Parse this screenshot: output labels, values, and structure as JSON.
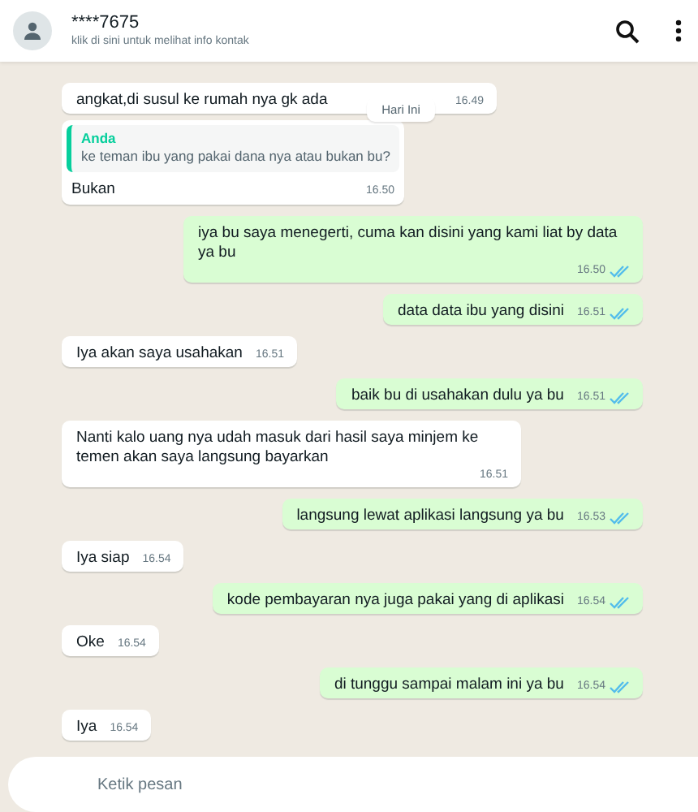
{
  "header": {
    "contact": "****7675",
    "subtitle": "klik di sini untuk melihat info kontak"
  },
  "messages": [
    {
      "kind": "incoming",
      "text": "angkat,di susul ke rumah nya gk ada",
      "time": "16.49"
    },
    {
      "kind": "date",
      "text": "Hari Ini"
    },
    {
      "kind": "incoming",
      "quote": {
        "author": "Anda",
        "text": "ke teman ibu yang pakai dana nya atau bukan bu?"
      },
      "text": "Bukan",
      "time": "16.50"
    },
    {
      "kind": "outgoing",
      "text": "iya bu saya menegerti, cuma kan disini yang kami liat by data ya bu",
      "time": "16.50",
      "read": true
    },
    {
      "kind": "outgoing",
      "text": "data data ibu yang disini",
      "time": "16.51",
      "read": true
    },
    {
      "kind": "incoming",
      "text": "Iya akan saya usahakan",
      "time": "16.51"
    },
    {
      "kind": "outgoing",
      "text": "baik bu di usahakan dulu ya bu",
      "time": "16.51",
      "read": true
    },
    {
      "kind": "incoming",
      "text": "Nanti kalo uang nya udah masuk dari hasil saya minjem ke temen akan saya langsung bayarkan",
      "time": "16.51"
    },
    {
      "kind": "outgoing",
      "text": "langsung lewat aplikasi langsung ya bu",
      "time": "16.53",
      "read": true
    },
    {
      "kind": "incoming",
      "text": "Iya siap",
      "time": "16.54"
    },
    {
      "kind": "outgoing",
      "text": "kode pembayaran nya juga pakai yang di aplikasi",
      "time": "16.54",
      "read": true
    },
    {
      "kind": "incoming",
      "text": "Oke",
      "time": "16.54"
    },
    {
      "kind": "outgoing",
      "text": "di tunggu sampai malam ini ya bu",
      "time": "16.54",
      "read": true
    },
    {
      "kind": "incoming",
      "text": "Iya",
      "time": "16.54"
    }
  ],
  "composer": {
    "placeholder": "Ketik pesan"
  }
}
